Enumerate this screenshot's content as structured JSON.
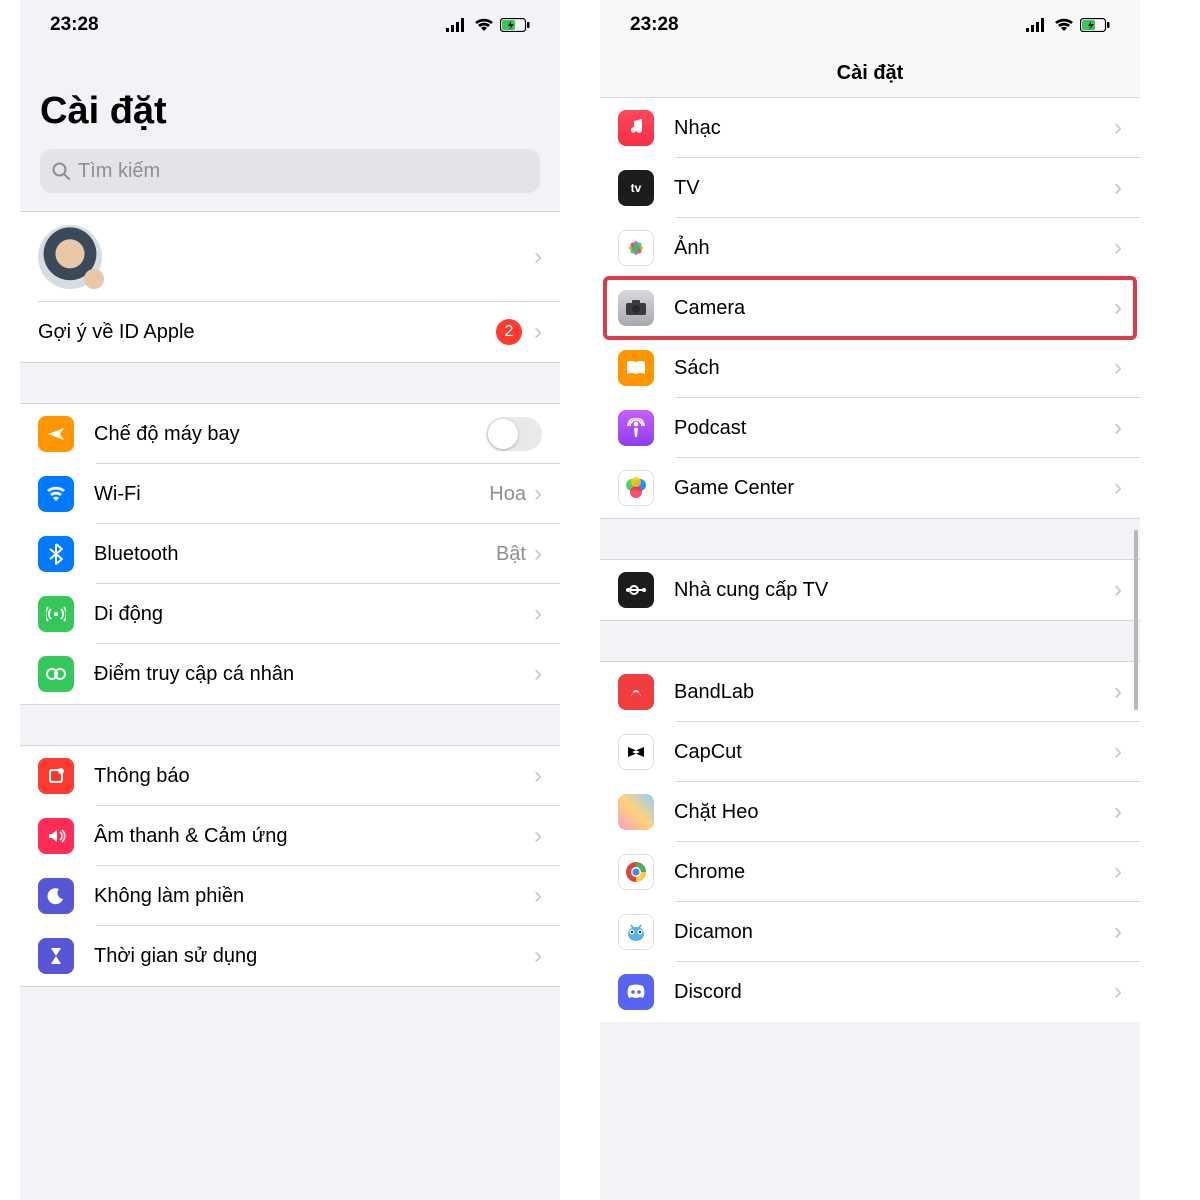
{
  "status": {
    "time": "23:28"
  },
  "left": {
    "title": "Cài đặt",
    "search_placeholder": "Tìm kiếm",
    "apple_id_suggestion": "Gợi ý về ID Apple",
    "apple_id_badge": "2",
    "rows": {
      "airplane": "Chế độ máy bay",
      "wifi": "Wi-Fi",
      "wifi_value": "Hoa",
      "bluetooth": "Bluetooth",
      "bluetooth_value": "Bật",
      "cellular": "Di động",
      "hotspot": "Điểm truy cập cá nhân",
      "notifications": "Thông báo",
      "sounds": "Âm thanh & Cảm ứng",
      "dnd": "Không làm phiền",
      "screentime": "Thời gian sử dụng"
    }
  },
  "right": {
    "nav_title": "Cài đặt",
    "rows": {
      "music": "Nhạc",
      "tv": "TV",
      "photos": "Ảnh",
      "camera": "Camera",
      "books": "Sách",
      "podcast": "Podcast",
      "gamecenter": "Game Center",
      "tvprovider": "Nhà cung cấp TV",
      "bandlab": "BandLab",
      "capcut": "CapCut",
      "chatheo": "Chặt Heo",
      "chrome": "Chrome",
      "dicamon": "Dicamon",
      "discord": "Discord"
    }
  }
}
